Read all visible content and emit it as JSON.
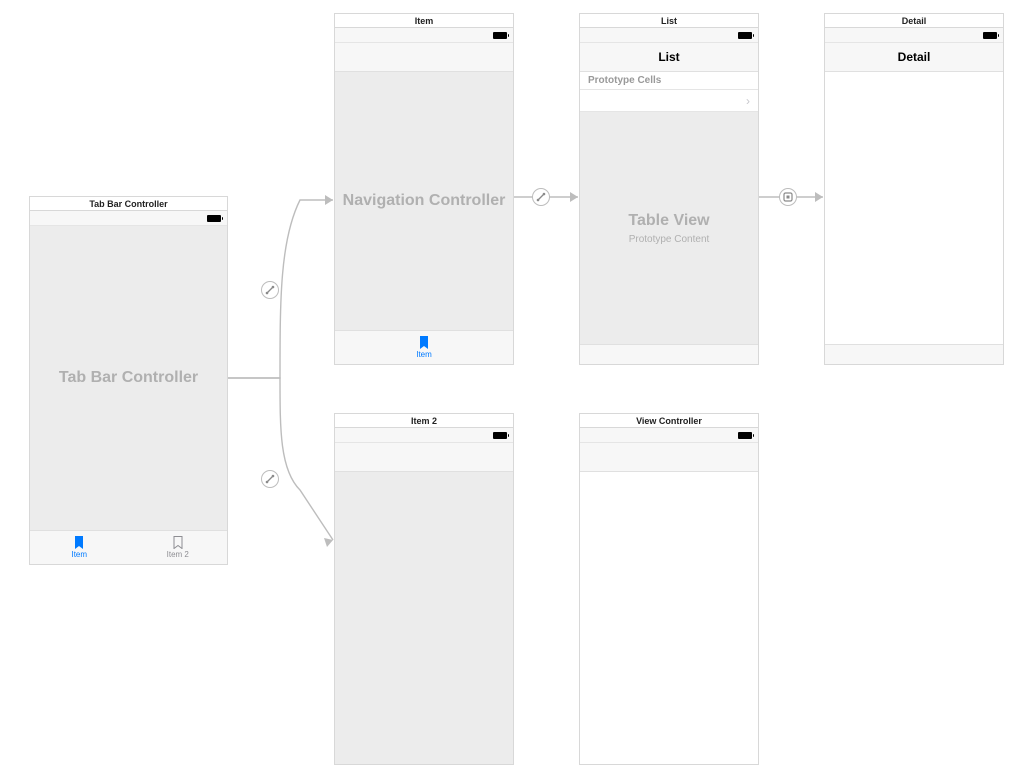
{
  "scenes": {
    "tabbar": {
      "title": "Tab Bar Controller",
      "placeholder": "Tab Bar Controller",
      "tabs": [
        {
          "label": "Item",
          "active": true
        },
        {
          "label": "Item 2",
          "active": false
        }
      ]
    },
    "item": {
      "title": "Item",
      "placeholder": "Navigation Controller",
      "tab_label": "Item"
    },
    "list": {
      "title": "List",
      "nav_title": "List",
      "section_header": "Prototype Cells",
      "table_placeholder_title": "Table View",
      "table_placeholder_sub": "Prototype Content"
    },
    "detail": {
      "title": "Detail",
      "nav_title": "Detail"
    },
    "item2": {
      "title": "Item 2"
    },
    "viewcontroller": {
      "title": "View Controller"
    }
  },
  "segues": {
    "relationship1": "relationship",
    "relationship2": "relationship",
    "root": "root",
    "show": "show"
  }
}
